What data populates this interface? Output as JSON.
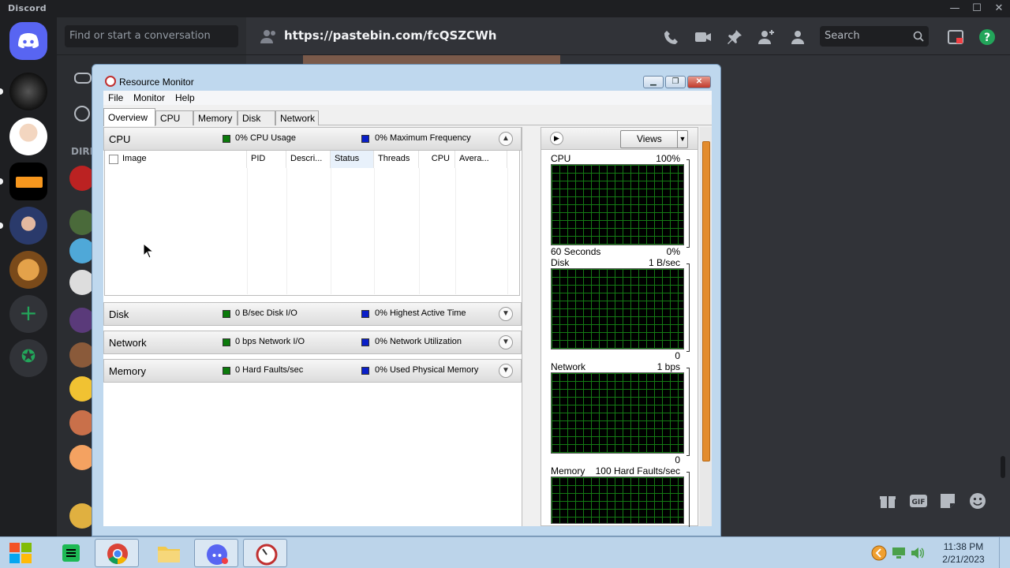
{
  "discord": {
    "title": "Discord",
    "dm_search_placeholder": "Find or start a conversation",
    "dm_section_label": "DIRE",
    "channel_url": "https://pastebin.com/fcQSZCWh",
    "search_placeholder": "Search"
  },
  "resource_monitor": {
    "window_title": "Resource Monitor",
    "menu": [
      "File",
      "Monitor",
      "Help"
    ],
    "tabs": [
      "Overview",
      "CPU",
      "Memory",
      "Disk",
      "Network"
    ],
    "active_tab": "Overview",
    "sections": {
      "cpu": {
        "title": "CPU",
        "stat1": "0% CPU Usage",
        "stat2": "0% Maximum Frequency"
      },
      "disk": {
        "title": "Disk",
        "stat1": "0 B/sec Disk I/O",
        "stat2": "0% Highest Active Time"
      },
      "network": {
        "title": "Network",
        "stat1": "0 bps Network I/O",
        "stat2": "0% Network Utilization"
      },
      "memory": {
        "title": "Memory",
        "stat1": "0 Hard Faults/sec",
        "stat2": "0% Used Physical Memory"
      }
    },
    "cpu_columns": [
      "Image",
      "PID",
      "Descri...",
      "Status",
      "Threads",
      "CPU",
      "Avera..."
    ],
    "views_label": "Views",
    "graphs": {
      "cpu": {
        "label": "CPU",
        "max": "100%",
        "footer_left": "60 Seconds",
        "footer_right": "0%"
      },
      "disk": {
        "label": "Disk",
        "max": "1 B/sec",
        "footer_right": "0"
      },
      "network": {
        "label": "Network",
        "max": "1 bps",
        "footer_right": "0"
      },
      "memory": {
        "label": "Memory",
        "max": "100 Hard Faults/sec"
      }
    }
  },
  "taskbar": {
    "time": "11:38 PM",
    "date": "2/21/2023"
  },
  "colors": {
    "discord_blurple": "#5865f2",
    "graph_grid": "#147a14",
    "cpu_legend": "#0b7a0b",
    "frequency_legend": "#0a1fc8",
    "online_green": "#23a55a"
  }
}
